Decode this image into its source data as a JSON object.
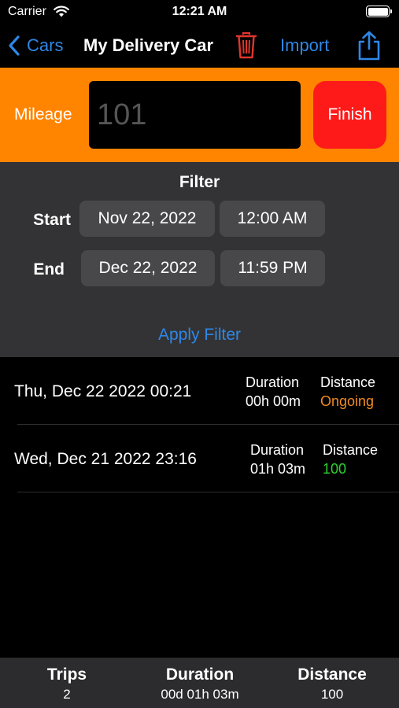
{
  "status": {
    "carrier": "Carrier",
    "time": "12:21 AM"
  },
  "nav": {
    "back_label": "Cars",
    "title": "My Delivery Car",
    "import_label": "Import"
  },
  "mileage": {
    "label": "Mileage",
    "placeholder": "101",
    "finish_label": "Finish"
  },
  "filter": {
    "title": "Filter",
    "start_label": "Start",
    "start_date": "Nov 22, 2022",
    "start_time": "12:00 AM",
    "end_label": "End",
    "end_date": "Dec 22, 2022",
    "end_time": "11:59 PM",
    "apply_label": "Apply Filter"
  },
  "trips": [
    {
      "date": "Thu, Dec 22 2022 00:21",
      "duration_label": "Duration",
      "duration": "00h 00m",
      "distance_label": "Distance",
      "distance": "Ongoing",
      "distance_color": "#f08a24"
    },
    {
      "date": "Wed, Dec 21 2022 23:16",
      "duration_label": "Duration",
      "duration": "01h 03m",
      "distance_label": "Distance",
      "distance": "100",
      "distance_color": "#2bd42b"
    }
  ],
  "summary": {
    "trips_label": "Trips",
    "trips": "2",
    "duration_label": "Duration",
    "duration": "00d 01h 03m",
    "distance_label": "Distance",
    "distance": "100"
  },
  "colors": {
    "accent": "#2f87e6",
    "mileage_bar": "#ff8400",
    "finish": "#ff1a1a",
    "trash": "#e0362c"
  },
  "icons": [
    "back-chevron-icon",
    "trash-icon",
    "share-icon",
    "wifi-icon",
    "battery-icon"
  ]
}
